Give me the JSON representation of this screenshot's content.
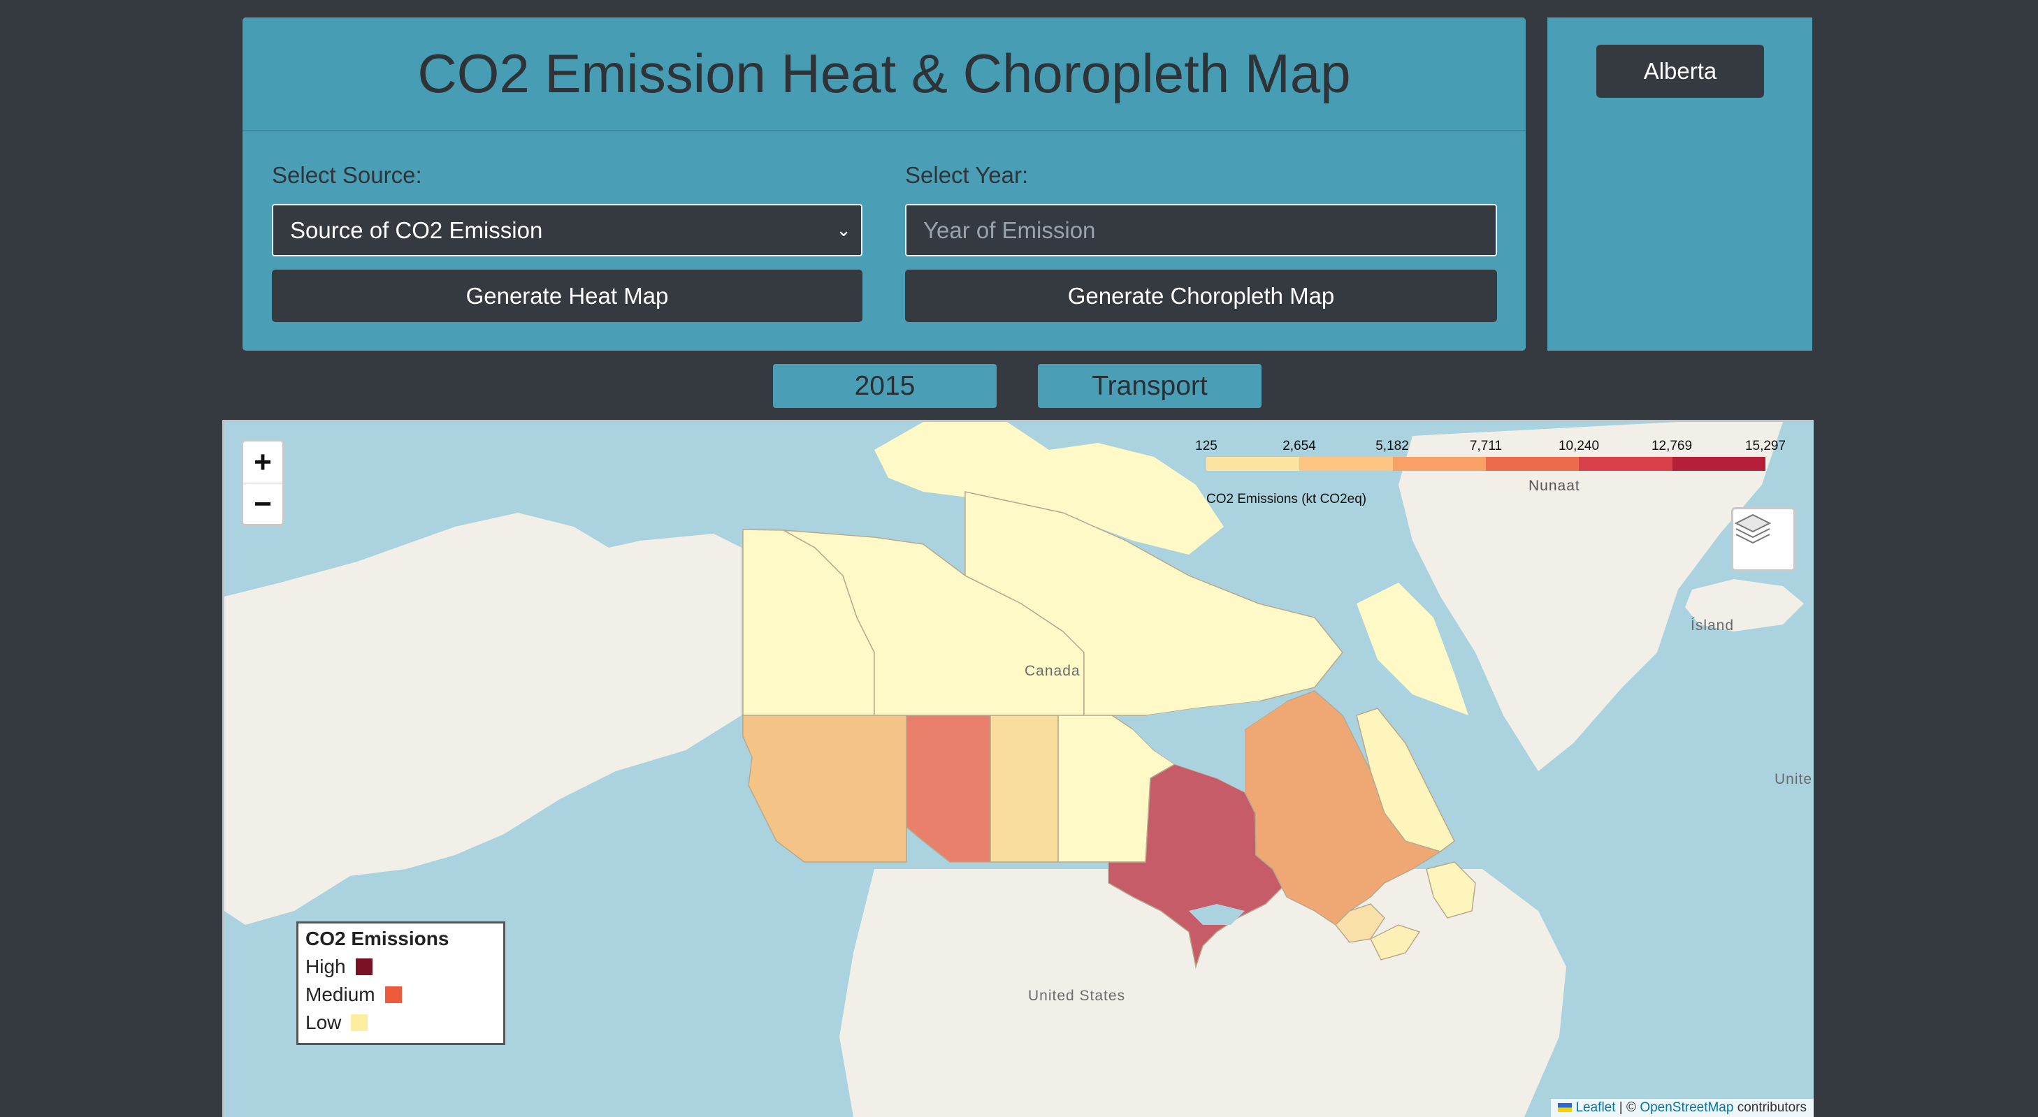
{
  "header": {
    "title": "CO2 Emission Heat & Choropleth Map"
  },
  "controls": {
    "source_label": "Select Source:",
    "source_value": "Source of CO2 Emission",
    "year_label": "Select Year:",
    "year_placeholder": "Year of Emission",
    "heat_button": "Generate Heat Map",
    "choropleth_button": "Generate Choropleth Map"
  },
  "side": {
    "province_button": "Alberta"
  },
  "chips": {
    "year": "2015",
    "source": "Transport"
  },
  "map": {
    "zoom_in": "+",
    "zoom_out": "−",
    "scale": {
      "ticks": [
        "125",
        "2,654",
        "5,182",
        "7,711",
        "10,240",
        "12,769",
        "15,297"
      ],
      "caption": "CO2 Emissions (kt CO2eq)",
      "colors": [
        "#fff8c2",
        "#fde3a0",
        "#fdc382",
        "#f9a066",
        "#ee6a4c",
        "#d8414a",
        "#b51f3a"
      ]
    },
    "legend": {
      "title": "CO2 Emissions",
      "items": [
        {
          "label": "High",
          "color": "#7b1124"
        },
        {
          "label": "Medium",
          "color": "#ec5b3c"
        },
        {
          "label": "Low",
          "color": "#fcee9f"
        }
      ]
    },
    "place_labels": {
      "canada": "Canada",
      "nunaat": "Nunaat",
      "island": "Ísland",
      "united_states": "United States",
      "united": "Unite"
    },
    "provinces": [
      {
        "name": "Yukon",
        "level": "Low",
        "color": "#fef9c6"
      },
      {
        "name": "Northwest Territories",
        "level": "Low",
        "color": "#fef9c6"
      },
      {
        "name": "Nunavut",
        "level": "Low",
        "color": "#fef9c6"
      },
      {
        "name": "British Columbia",
        "level": "Medium",
        "color": "#f3c486"
      },
      {
        "name": "Alberta",
        "level": "Medium",
        "color": "#e8806b"
      },
      {
        "name": "Saskatchewan",
        "level": "Low",
        "color": "#f8dd9f"
      },
      {
        "name": "Manitoba",
        "level": "Low",
        "color": "#fef9c6"
      },
      {
        "name": "Ontario",
        "level": "High",
        "color": "#c75c69"
      },
      {
        "name": "Quebec",
        "level": "Medium",
        "color": "#efa874"
      },
      {
        "name": "Newfoundland and Labrador",
        "level": "Low",
        "color": "#fef5bd"
      },
      {
        "name": "New Brunswick",
        "level": "Low",
        "color": "#f9e0a9"
      },
      {
        "name": "Nova Scotia",
        "level": "Low",
        "color": "#fdf0b7"
      }
    ],
    "attribution": {
      "leaflet": "Leaflet",
      "sep": " | © ",
      "osm": "OpenStreetMap",
      "suffix": " contributors"
    }
  }
}
